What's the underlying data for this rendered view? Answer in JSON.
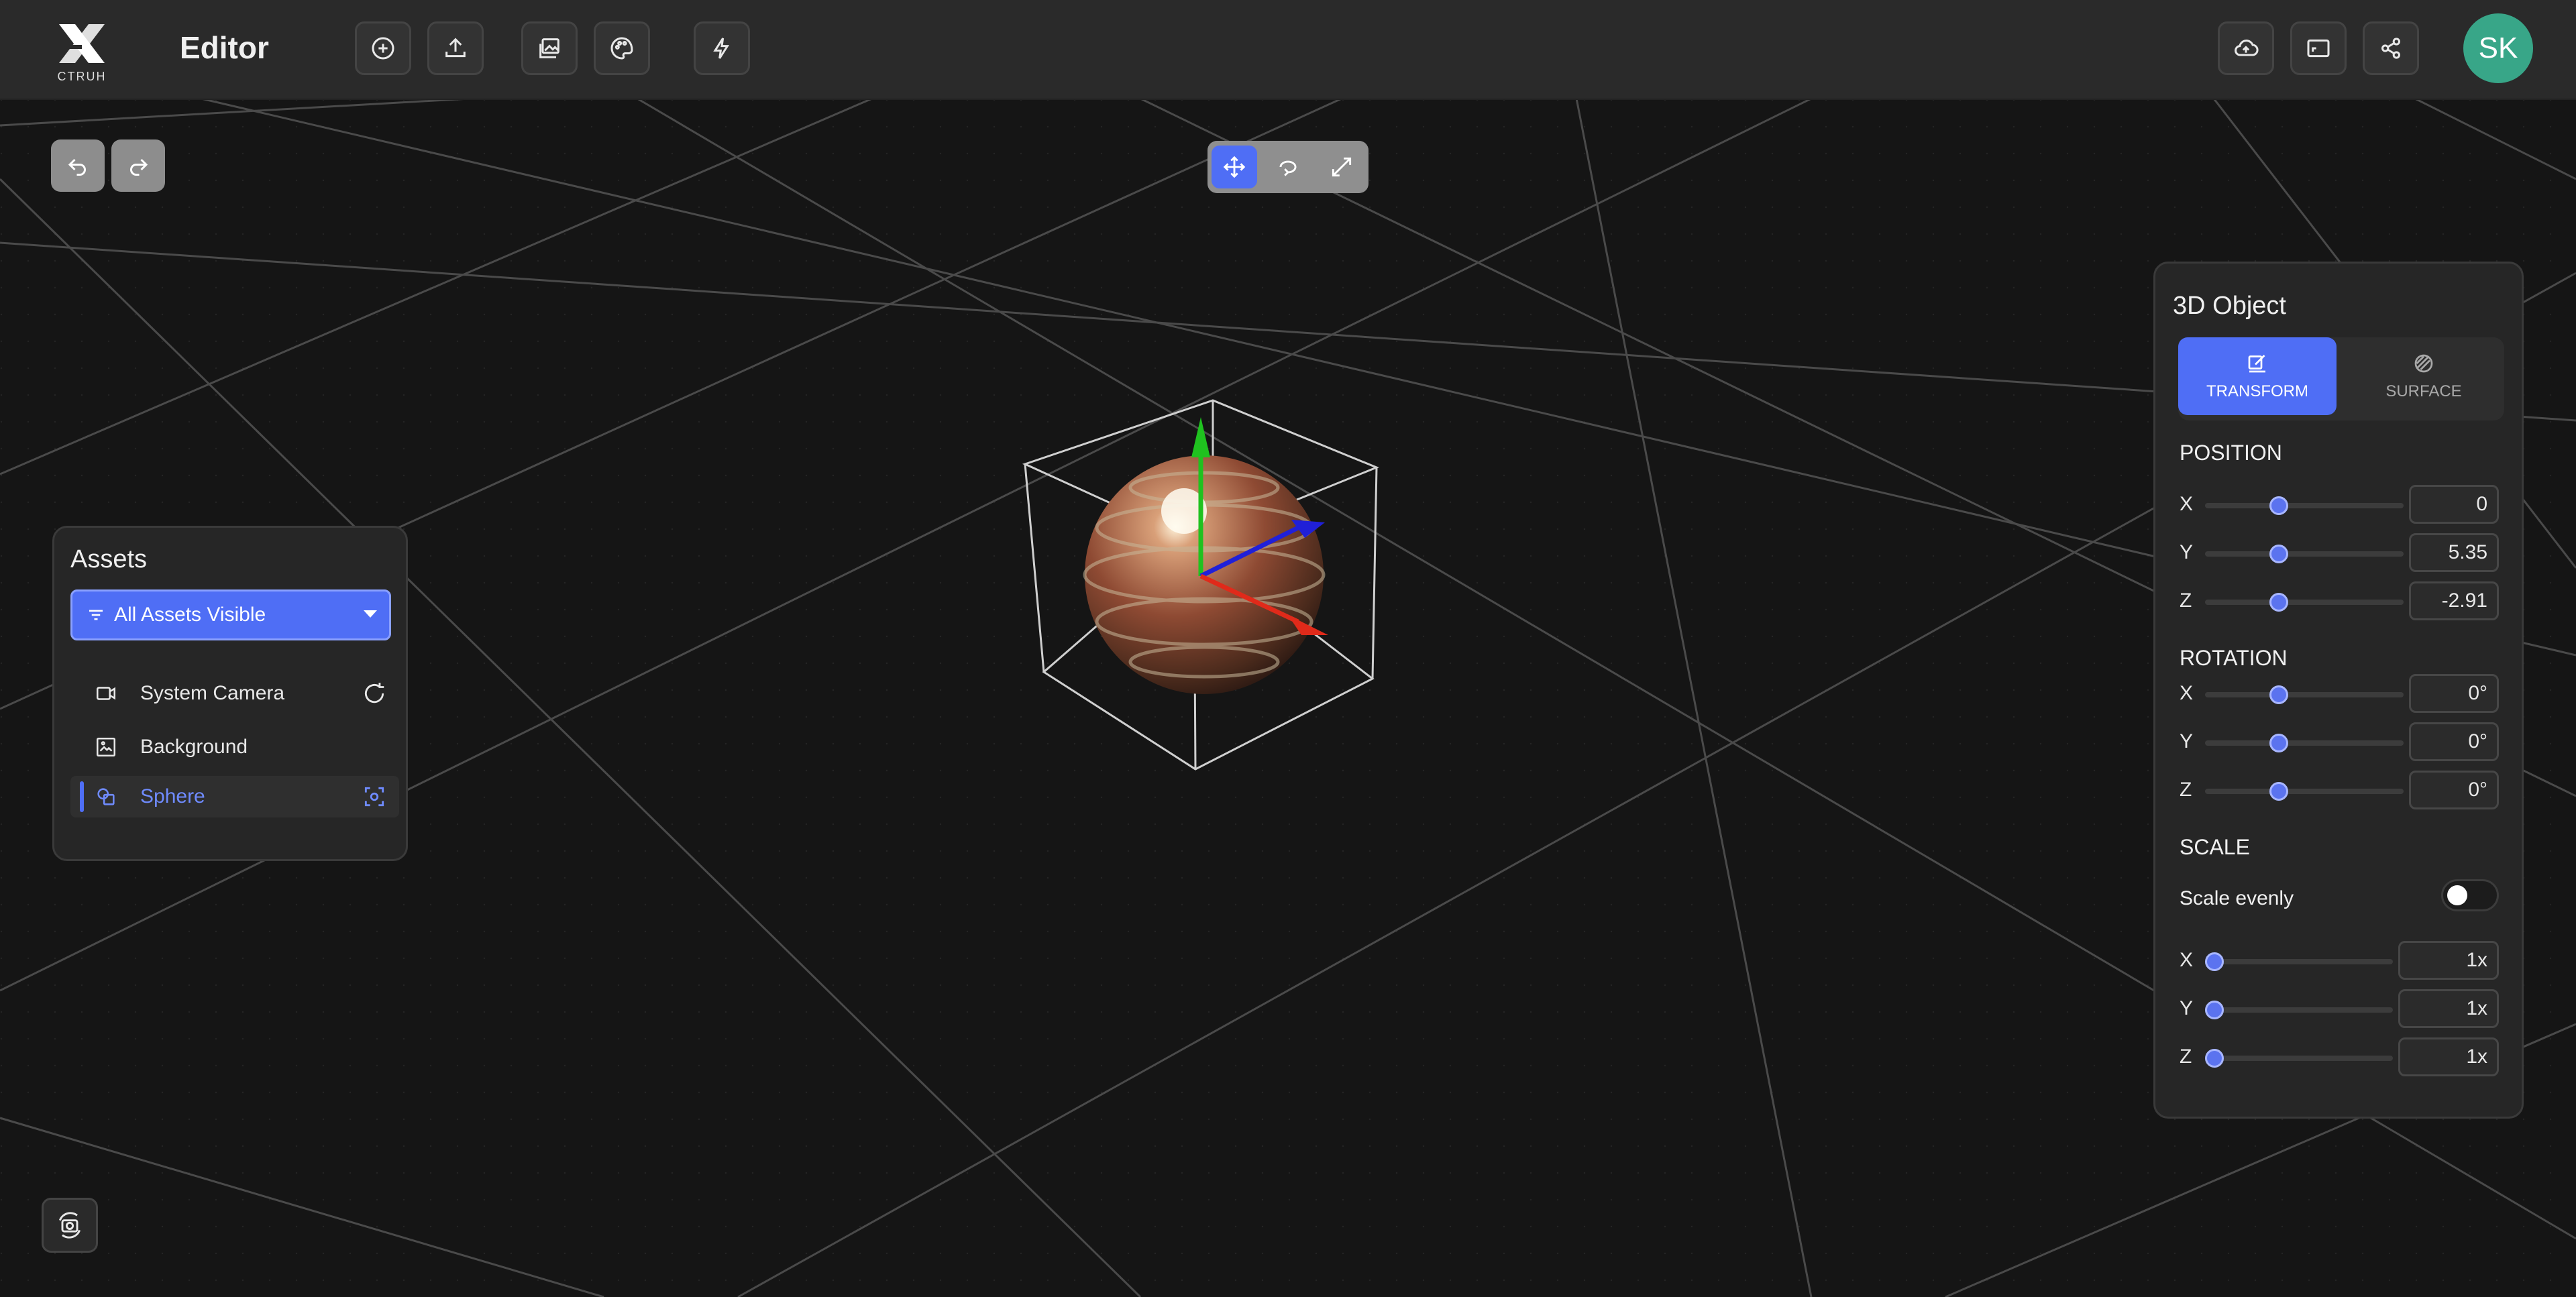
{
  "app": {
    "logo_text": "CTRUH",
    "title": "Editor",
    "avatar_initials": "SK"
  },
  "toolbar": {
    "left_icons": [
      "add-icon",
      "upload-icon",
      "gallery-icon",
      "palette-icon",
      "lightning-icon"
    ],
    "right_icons": [
      "cloud-upload-icon",
      "preview-icon",
      "share-icon"
    ]
  },
  "history": {
    "icons": [
      "undo-icon",
      "redo-icon"
    ]
  },
  "gizmo_modes": {
    "active": "move",
    "icons": [
      "move-icon",
      "rotate-icon",
      "scale-icon"
    ]
  },
  "assets": {
    "title": "Assets",
    "filter": "All Assets Visible",
    "items": [
      {
        "label": "System Camera",
        "icon": "camera-icon",
        "action_icon": "reset-icon"
      },
      {
        "label": "Background",
        "icon": "image-icon"
      },
      {
        "label": "Sphere",
        "icon": "shapes-icon",
        "action_icon": "focus-icon",
        "selected": true
      }
    ]
  },
  "object_panel": {
    "title": "3D Object",
    "tabs": [
      {
        "label": "TRANSFORM",
        "icon": "edit-icon",
        "active": true
      },
      {
        "label": "SURFACE",
        "icon": "material-icon",
        "active": false
      }
    ],
    "position": {
      "title": "POSITION",
      "x": {
        "label": "X",
        "value": "0"
      },
      "y": {
        "label": "Y",
        "value": "5.35"
      },
      "z": {
        "label": "Z",
        "value": "-2.91"
      }
    },
    "rotation": {
      "title": "ROTATION",
      "x": {
        "label": "X",
        "value": "0°"
      },
      "y": {
        "label": "Y",
        "value": "0°"
      },
      "z": {
        "label": "Z",
        "value": "0°"
      }
    },
    "scale": {
      "title": "SCALE",
      "evenly_label": "Scale evenly",
      "evenly_on": false,
      "x": {
        "label": "X",
        "value": "1x"
      },
      "y": {
        "label": "Y",
        "value": "1x"
      },
      "z": {
        "label": "Z",
        "value": "1x"
      }
    }
  },
  "accent_color": "#4f6ef5"
}
